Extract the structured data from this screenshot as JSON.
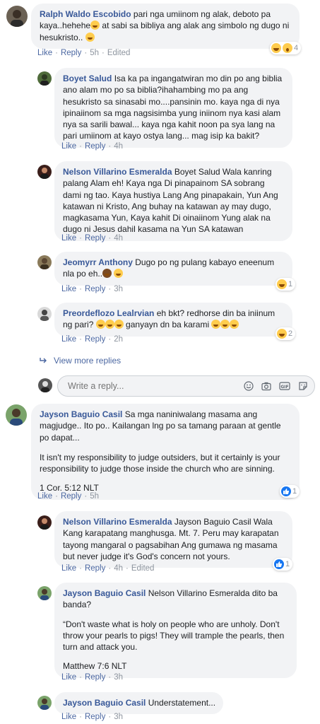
{
  "comments": [
    {
      "name": "Ralph Waldo Escobido",
      "text": "pari nga umiinom ng alak, deboto pa kaya..hehehe",
      "text2": " at sabi sa bibliya ang alak ang simbolo ng dugo ni hesukristo.. ",
      "like": "Like",
      "reply": "Reply",
      "time": "5h",
      "edited": "Edited",
      "reaction_count": "4"
    },
    {
      "name": "Boyet Salud",
      "text": "Isa ka pa ingangatwiran mo din po ang biblia ano alam mo po sa biblia?ihahambing mo pa ang hesukristo sa sinasabi mo....pansinin mo. kaya nga di nya ipinaiinom sa mga nagsisimba yung iniinom nya kasi alam nya sa sarili bawal... kaya nga kahit noon pa sya lang na pari umiinom at kayo ostya lang... mag isip ka bakit?",
      "like": "Like",
      "reply": "Reply",
      "time": "4h"
    },
    {
      "name": "Nelson Villarino Esmeralda",
      "text": "Boyet Salud Wala kanring palang Alam eh! Kaya nga Di pinapainom SA sobrang dami ng tao. Kaya hustiya Lang Ang pinapakain, Yun Ang katawan ni Kristo, Ang buhay na katawan ay may dugo, magkasama Yun, Kaya kahit Di oinaiinom Yung alak na dugo ni Jesus dahil kasama na Yun SA katawan",
      "like": "Like",
      "reply": "Reply",
      "time": "4h"
    },
    {
      "name": "Jeomyrr Anthony",
      "text": "Dugo po ng pulang kabayo eneenum nla po eh..",
      "like": "Like",
      "reply": "Reply",
      "time": "3h",
      "reaction_count": "1"
    },
    {
      "name": "Preordeflozo Lealrvian",
      "text": "eh bkt? redhorse din ba iniinum ng pari?",
      "text2": " ganyayn dn ba karami ",
      "like": "Like",
      "reply": "Reply",
      "time": "2h",
      "reaction_count": "2"
    },
    {
      "name": "Jayson Baguio Casil",
      "text": "Sa mga naniniwalang masama ang magjudge.. Ito po.. Kailangan lng po sa tamang paraan at gentle po dapat...",
      "para2": "It isn't my responsibility to judge outsiders, but it certainly is your responsibility to judge those inside the church who are sinning.",
      "para3": "1 Cor. 5:12 NLT",
      "like": "Like",
      "reply": "Reply",
      "time": "5h",
      "reaction_count": "1"
    },
    {
      "name": "Nelson Villarino Esmeralda",
      "text": "Jayson Baguio Casil Wala Kang karapatang manghusga. Mt. 7. Peru may karapatan tayong mangaral o pagsabihan Ang gumawa ng masama but never judge it's God's concern not yours.",
      "like": "Like",
      "reply": "Reply",
      "time": "4h",
      "edited": "Edited",
      "reaction_count": "1"
    },
    {
      "name": "Jayson Baguio Casil",
      "text": "Nelson Villarino Esmeralda dito ba banda?",
      "para2": "“Don't waste what is holy on people who are unholy. Don't throw your pearls to pigs! They will trample the pearls, then turn and attack you.",
      "para3": "Matthew 7:6 NLT",
      "like": "Like",
      "reply": "Reply",
      "time": "3h"
    },
    {
      "name": "Jayson Baguio Casil",
      "text": "Understatement...",
      "like": "Like",
      "reply": "Reply",
      "time": "3h"
    }
  ],
  "view_more": "View more replies",
  "reply_box": {
    "placeholder": "Write a reply..."
  },
  "colors": {
    "name": "#385898",
    "link": "#4b67a1",
    "bubble": "#f2f3f5",
    "muted": "#8d949e",
    "like_blue": "#1877f2",
    "emoji_yellow": "#ffcc4d"
  },
  "icons": [
    "emoji-icon",
    "camera-icon",
    "gif-icon",
    "sticker-icon",
    "reply-arrow-icon",
    "like-reaction-icon",
    "haha-reaction-icon",
    "wow-reaction-icon"
  ]
}
